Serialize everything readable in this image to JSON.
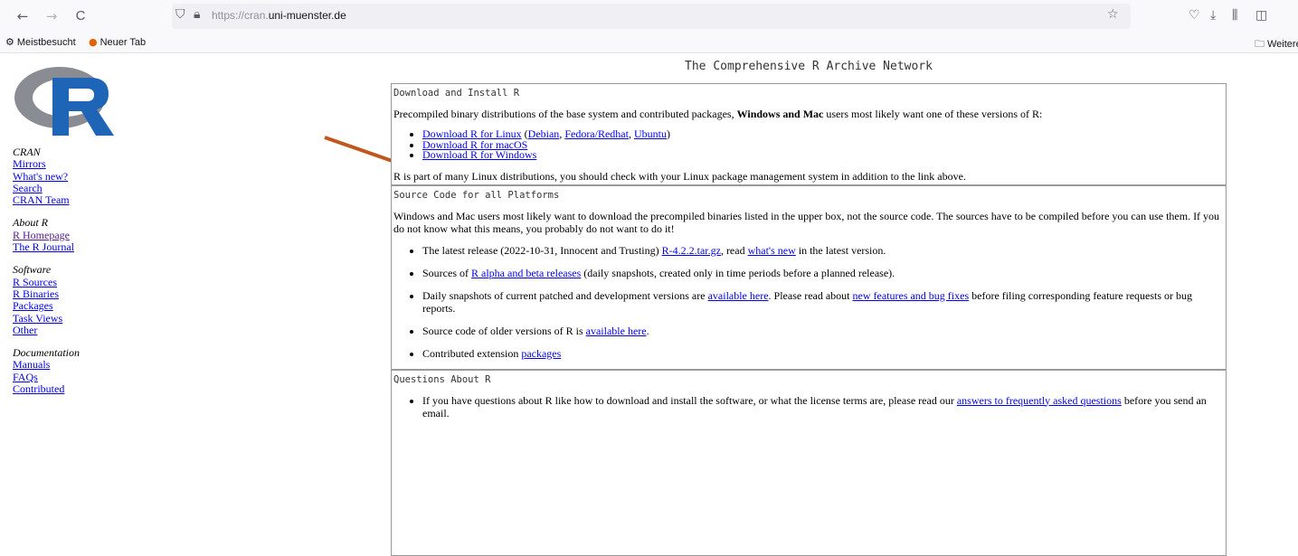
{
  "browser": {
    "url_prefix": "https://cran.",
    "url_domain": "uni-muenster.de",
    "bookmarks": [
      {
        "label": "Meistbesucht",
        "icon": "gear-icon"
      },
      {
        "label": "Neuer Tab",
        "icon": "firefox-icon"
      }
    ],
    "other_bookmarks": "Weitere",
    "icons": {
      "back": "←",
      "forward": "→",
      "reload": "C"
    }
  },
  "sidebar": {
    "groups": [
      {
        "heading": "CRAN",
        "links": [
          "Mirrors",
          "What's new?",
          "Search",
          "CRAN Team"
        ]
      },
      {
        "heading": "About R",
        "links": [
          "R Homepage",
          "The R Journal"
        ]
      },
      {
        "heading": "Software",
        "links": [
          "R Sources",
          "R Binaries",
          "Packages",
          "Task Views",
          "Other"
        ]
      },
      {
        "heading": "Documentation",
        "links": [
          "Manuals",
          "FAQs",
          "Contributed"
        ]
      }
    ]
  },
  "main": {
    "title": "The Comprehensive R Archive Network",
    "download": {
      "heading": "Download and Install R",
      "intro_a": "Precompiled binary distributions of the base system and contributed packages, ",
      "intro_bold": "Windows and Mac",
      "intro_b": " users most likely want one of these versions of R:",
      "linux": "Download R for Linux",
      "debian": "Debian",
      "fedora": "Fedora/Redhat",
      "ubuntu": "Ubuntu",
      "macos": "Download R for macOS",
      "windows": "Download R for Windows",
      "note": "R is part of many Linux distributions, you should check with your Linux package management system in addition to the link above."
    },
    "source": {
      "heading": "Source Code for all Platforms",
      "intro": "Windows and Mac users most likely want to download the precompiled binaries listed in the upper box, not the source code. The sources have to be compiled before you can use them. If you do not know what this means, you probably do not want to do it!",
      "latest_a": "The latest release (2022-10-31, Innocent and Trusting) ",
      "latest_link": "R-4.2.2.tar.gz",
      "latest_b": ", read ",
      "latest_link2": "what's new",
      "latest_c": " in the latest version.",
      "alpha_a": "Sources of ",
      "alpha_link": "R alpha and beta releases",
      "alpha_b": " (daily snapshots, created only in time periods before a planned release).",
      "daily_a": "Daily snapshots of current patched and development versions are ",
      "daily_link": "available here",
      "daily_b": ". Please read about ",
      "daily_link2": "new features and bug fixes",
      "daily_c": " before filing corresponding feature requests or bug reports.",
      "older_a": "Source code of older versions of R is ",
      "older_link": "available here",
      "older_b": ".",
      "contrib_a": "Contributed extension ",
      "contrib_link": "packages"
    },
    "questions": {
      "heading": "Questions About R",
      "item_a": "If you have questions about R like how to download and install the software, or what the license terms are, please read our ",
      "item_link": "answers to frequently asked questions",
      "item_b": " before you send an email."
    }
  },
  "colors": {
    "link": "#0000ee",
    "arrow": "#c0571e",
    "logo_blue": "#1f65b7",
    "logo_gray": "#8a8c94"
  }
}
